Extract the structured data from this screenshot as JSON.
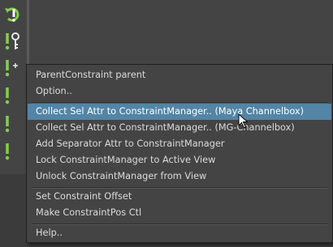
{
  "colors": {
    "background": "#444444",
    "menu_text": "#dcdcdc",
    "highlight": "#5285a6",
    "icon_green": "#7fd14a"
  },
  "toolbar": {
    "icons": [
      "refresh-constraint-icon",
      "key-constraint-icon",
      "constraint-icon",
      "constraint-icon",
      "constraint-icon",
      "constraint-icon"
    ]
  },
  "menu": {
    "items": [
      {
        "label": "ParentConstraint parent"
      },
      {
        "label": "Option.."
      },
      {
        "label": "Collect Sel Attr to ConstraintManager.. (Maya Channelbox)"
      },
      {
        "label": "Collect Sel Attr to ConstraintManager.. (MG-Channelbox)"
      },
      {
        "label": "Add Separator Attr to ConstraintManager"
      },
      {
        "label": "Lock ConstraintManager to Active View"
      },
      {
        "label": "Unlock ConstraintManager from View"
      },
      {
        "label": "Set Constraint Offset"
      },
      {
        "label": "Make ConstraintPos Ctl"
      },
      {
        "label": "Help.."
      }
    ]
  }
}
